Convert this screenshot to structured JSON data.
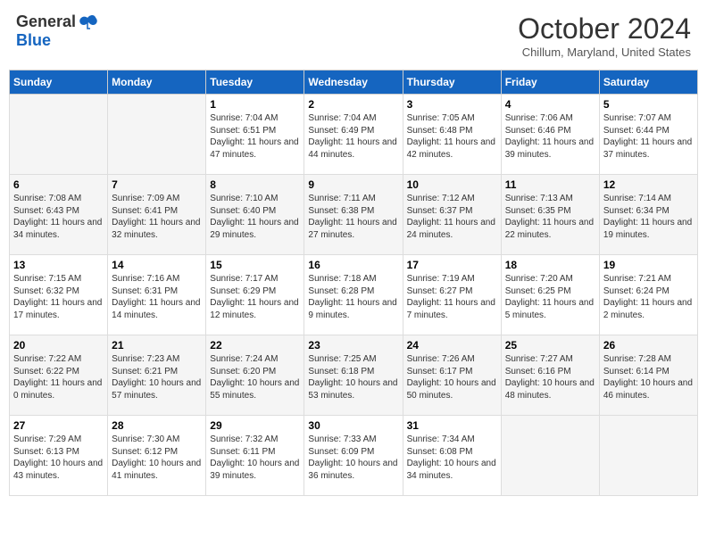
{
  "header": {
    "logo_general": "General",
    "logo_blue": "Blue",
    "month": "October 2024",
    "location": "Chillum, Maryland, United States"
  },
  "weekdays": [
    "Sunday",
    "Monday",
    "Tuesday",
    "Wednesday",
    "Thursday",
    "Friday",
    "Saturday"
  ],
  "weeks": [
    [
      {
        "day": "",
        "sunrise": "",
        "sunset": "",
        "daylight": ""
      },
      {
        "day": "",
        "sunrise": "",
        "sunset": "",
        "daylight": ""
      },
      {
        "day": "1",
        "sunrise": "Sunrise: 7:04 AM",
        "sunset": "Sunset: 6:51 PM",
        "daylight": "Daylight: 11 hours and 47 minutes."
      },
      {
        "day": "2",
        "sunrise": "Sunrise: 7:04 AM",
        "sunset": "Sunset: 6:49 PM",
        "daylight": "Daylight: 11 hours and 44 minutes."
      },
      {
        "day": "3",
        "sunrise": "Sunrise: 7:05 AM",
        "sunset": "Sunset: 6:48 PM",
        "daylight": "Daylight: 11 hours and 42 minutes."
      },
      {
        "day": "4",
        "sunrise": "Sunrise: 7:06 AM",
        "sunset": "Sunset: 6:46 PM",
        "daylight": "Daylight: 11 hours and 39 minutes."
      },
      {
        "day": "5",
        "sunrise": "Sunrise: 7:07 AM",
        "sunset": "Sunset: 6:44 PM",
        "daylight": "Daylight: 11 hours and 37 minutes."
      }
    ],
    [
      {
        "day": "6",
        "sunrise": "Sunrise: 7:08 AM",
        "sunset": "Sunset: 6:43 PM",
        "daylight": "Daylight: 11 hours and 34 minutes."
      },
      {
        "day": "7",
        "sunrise": "Sunrise: 7:09 AM",
        "sunset": "Sunset: 6:41 PM",
        "daylight": "Daylight: 11 hours and 32 minutes."
      },
      {
        "day": "8",
        "sunrise": "Sunrise: 7:10 AM",
        "sunset": "Sunset: 6:40 PM",
        "daylight": "Daylight: 11 hours and 29 minutes."
      },
      {
        "day": "9",
        "sunrise": "Sunrise: 7:11 AM",
        "sunset": "Sunset: 6:38 PM",
        "daylight": "Daylight: 11 hours and 27 minutes."
      },
      {
        "day": "10",
        "sunrise": "Sunrise: 7:12 AM",
        "sunset": "Sunset: 6:37 PM",
        "daylight": "Daylight: 11 hours and 24 minutes."
      },
      {
        "day": "11",
        "sunrise": "Sunrise: 7:13 AM",
        "sunset": "Sunset: 6:35 PM",
        "daylight": "Daylight: 11 hours and 22 minutes."
      },
      {
        "day": "12",
        "sunrise": "Sunrise: 7:14 AM",
        "sunset": "Sunset: 6:34 PM",
        "daylight": "Daylight: 11 hours and 19 minutes."
      }
    ],
    [
      {
        "day": "13",
        "sunrise": "Sunrise: 7:15 AM",
        "sunset": "Sunset: 6:32 PM",
        "daylight": "Daylight: 11 hours and 17 minutes."
      },
      {
        "day": "14",
        "sunrise": "Sunrise: 7:16 AM",
        "sunset": "Sunset: 6:31 PM",
        "daylight": "Daylight: 11 hours and 14 minutes."
      },
      {
        "day": "15",
        "sunrise": "Sunrise: 7:17 AM",
        "sunset": "Sunset: 6:29 PM",
        "daylight": "Daylight: 11 hours and 12 minutes."
      },
      {
        "day": "16",
        "sunrise": "Sunrise: 7:18 AM",
        "sunset": "Sunset: 6:28 PM",
        "daylight": "Daylight: 11 hours and 9 minutes."
      },
      {
        "day": "17",
        "sunrise": "Sunrise: 7:19 AM",
        "sunset": "Sunset: 6:27 PM",
        "daylight": "Daylight: 11 hours and 7 minutes."
      },
      {
        "day": "18",
        "sunrise": "Sunrise: 7:20 AM",
        "sunset": "Sunset: 6:25 PM",
        "daylight": "Daylight: 11 hours and 5 minutes."
      },
      {
        "day": "19",
        "sunrise": "Sunrise: 7:21 AM",
        "sunset": "Sunset: 6:24 PM",
        "daylight": "Daylight: 11 hours and 2 minutes."
      }
    ],
    [
      {
        "day": "20",
        "sunrise": "Sunrise: 7:22 AM",
        "sunset": "Sunset: 6:22 PM",
        "daylight": "Daylight: 11 hours and 0 minutes."
      },
      {
        "day": "21",
        "sunrise": "Sunrise: 7:23 AM",
        "sunset": "Sunset: 6:21 PM",
        "daylight": "Daylight: 10 hours and 57 minutes."
      },
      {
        "day": "22",
        "sunrise": "Sunrise: 7:24 AM",
        "sunset": "Sunset: 6:20 PM",
        "daylight": "Daylight: 10 hours and 55 minutes."
      },
      {
        "day": "23",
        "sunrise": "Sunrise: 7:25 AM",
        "sunset": "Sunset: 6:18 PM",
        "daylight": "Daylight: 10 hours and 53 minutes."
      },
      {
        "day": "24",
        "sunrise": "Sunrise: 7:26 AM",
        "sunset": "Sunset: 6:17 PM",
        "daylight": "Daylight: 10 hours and 50 minutes."
      },
      {
        "day": "25",
        "sunrise": "Sunrise: 7:27 AM",
        "sunset": "Sunset: 6:16 PM",
        "daylight": "Daylight: 10 hours and 48 minutes."
      },
      {
        "day": "26",
        "sunrise": "Sunrise: 7:28 AM",
        "sunset": "Sunset: 6:14 PM",
        "daylight": "Daylight: 10 hours and 46 minutes."
      }
    ],
    [
      {
        "day": "27",
        "sunrise": "Sunrise: 7:29 AM",
        "sunset": "Sunset: 6:13 PM",
        "daylight": "Daylight: 10 hours and 43 minutes."
      },
      {
        "day": "28",
        "sunrise": "Sunrise: 7:30 AM",
        "sunset": "Sunset: 6:12 PM",
        "daylight": "Daylight: 10 hours and 41 minutes."
      },
      {
        "day": "29",
        "sunrise": "Sunrise: 7:32 AM",
        "sunset": "Sunset: 6:11 PM",
        "daylight": "Daylight: 10 hours and 39 minutes."
      },
      {
        "day": "30",
        "sunrise": "Sunrise: 7:33 AM",
        "sunset": "Sunset: 6:09 PM",
        "daylight": "Daylight: 10 hours and 36 minutes."
      },
      {
        "day": "31",
        "sunrise": "Sunrise: 7:34 AM",
        "sunset": "Sunset: 6:08 PM",
        "daylight": "Daylight: 10 hours and 34 minutes."
      },
      {
        "day": "",
        "sunrise": "",
        "sunset": "",
        "daylight": ""
      },
      {
        "day": "",
        "sunrise": "",
        "sunset": "",
        "daylight": ""
      }
    ]
  ]
}
